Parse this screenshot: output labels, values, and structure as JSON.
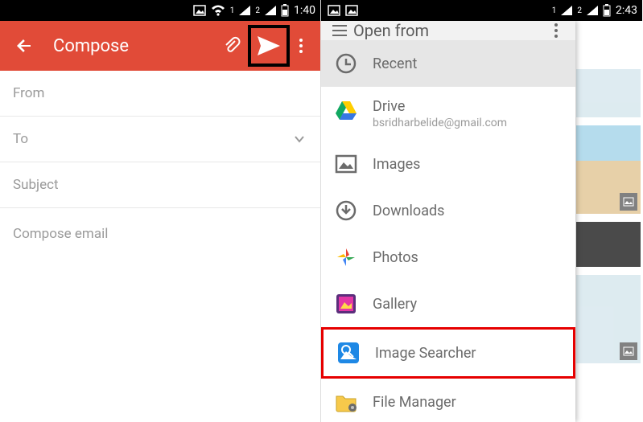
{
  "left": {
    "status": {
      "sim1": "1",
      "sim2": "2",
      "time": "1:40"
    },
    "appbar": {
      "title": "Compose"
    },
    "fields": {
      "from": "From",
      "to": "To",
      "subject": "Subject",
      "body_placeholder": "Compose email"
    }
  },
  "right": {
    "status": {
      "sim1": "1",
      "sim2": "2",
      "time": "2:43"
    },
    "drawer": {
      "title": "Open from",
      "items": [
        {
          "label": "Recent",
          "selected": true
        },
        {
          "label": "Drive",
          "sub": "bsridharbelide@gmail.com"
        },
        {
          "label": "Images"
        },
        {
          "label": "Downloads"
        },
        {
          "label": "Photos"
        },
        {
          "label": "Gallery"
        },
        {
          "label": "Image Searcher",
          "highlight": true
        },
        {
          "label": "File Manager"
        }
      ]
    }
  }
}
